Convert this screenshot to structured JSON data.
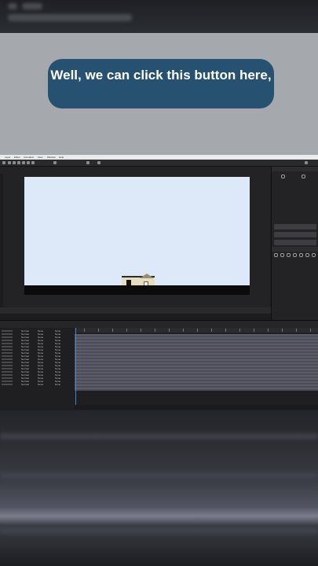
{
  "caption": {
    "text": "Well, we can click this button here,"
  },
  "app": {
    "menu": [
      "Layer",
      "Effect",
      "Animation",
      "View",
      "Window",
      "Help"
    ],
    "timeline": {
      "rows": [
        {
          "name": "Normal",
          "mode": "None",
          "parent": "None"
        },
        {
          "name": "Normal",
          "mode": "None",
          "parent": "None"
        },
        {
          "name": "Normal",
          "mode": "None",
          "parent": "None"
        },
        {
          "name": "Normal",
          "mode": "None",
          "parent": "None"
        },
        {
          "name": "Normal",
          "mode": "None",
          "parent": "None"
        },
        {
          "name": "Normal",
          "mode": "None",
          "parent": "None"
        },
        {
          "name": "Normal",
          "mode": "None",
          "parent": "None"
        },
        {
          "name": "Normal",
          "mode": "None",
          "parent": "None"
        },
        {
          "name": "Normal",
          "mode": "None",
          "parent": "None"
        },
        {
          "name": "Normal",
          "mode": "None",
          "parent": "None"
        },
        {
          "name": "Normal",
          "mode": "None",
          "parent": "None"
        },
        {
          "name": "Normal",
          "mode": "None",
          "parent": "None"
        },
        {
          "name": "Normal",
          "mode": "None",
          "parent": "None"
        },
        {
          "name": "Normal",
          "mode": "None",
          "parent": "None"
        },
        {
          "name": "Normal",
          "mode": "None",
          "parent": "None"
        },
        {
          "name": "Normal",
          "mode": "None",
          "parent": "None"
        },
        {
          "name": "Normal",
          "mode": "None",
          "parent": "None"
        },
        {
          "name": "Normal",
          "mode": "None",
          "parent": "None"
        }
      ]
    }
  },
  "colors": {
    "caption_bg": "#275170",
    "canvas_bg": "#dde9f8",
    "playhead": "#3f7fe0"
  }
}
